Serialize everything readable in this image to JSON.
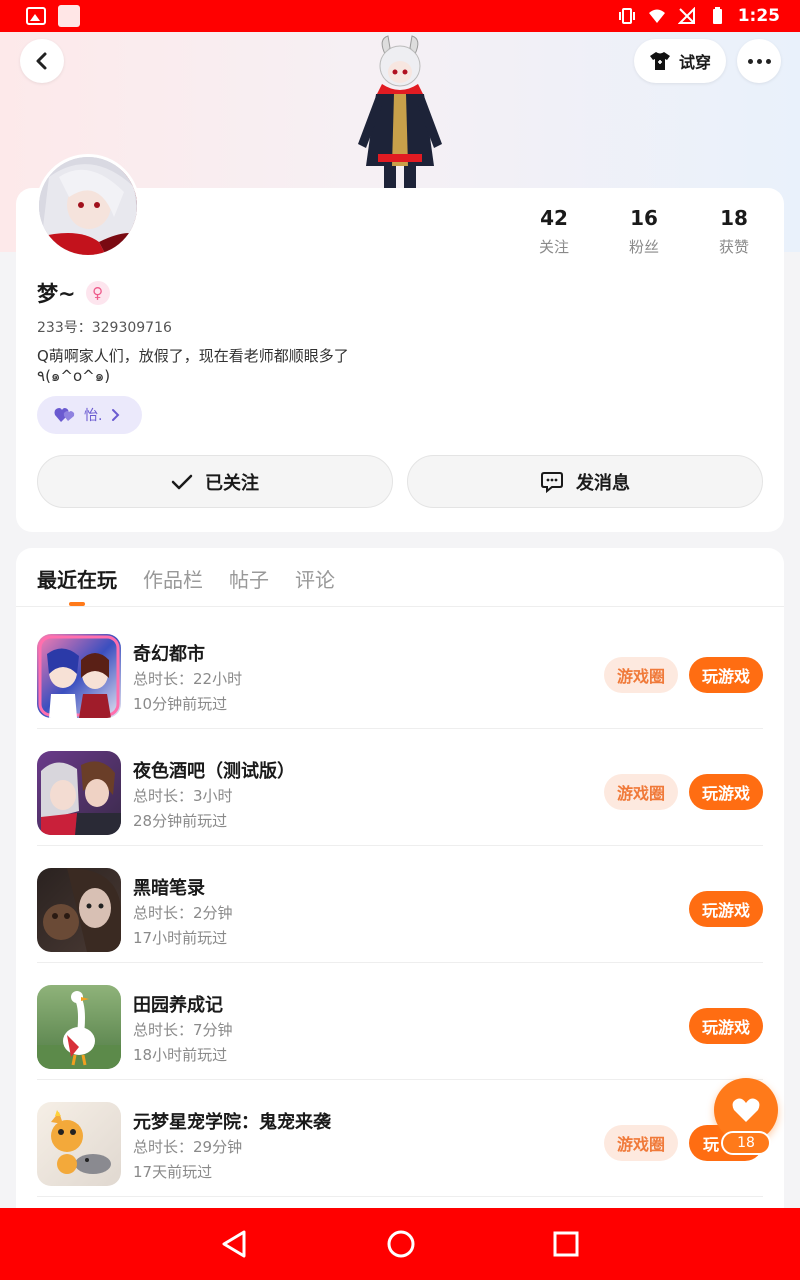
{
  "status_bar": {
    "time": "1:25"
  },
  "header": {
    "tryon_label": "试穿"
  },
  "profile": {
    "name": "梦~",
    "gender_symbol": "♀",
    "uid": "233号：329309716",
    "bio_line1": "Q萌啊家人们，放假了，现在看老师都顺眼多了",
    "bio_line2": "٩(๑^o^๑)",
    "tag_label": "怡.",
    "stats": [
      {
        "num": "42",
        "label": "关注"
      },
      {
        "num": "16",
        "label": "粉丝"
      },
      {
        "num": "18",
        "label": "获赞"
      }
    ],
    "follow_label": "已关注",
    "message_label": "发消息"
  },
  "tabs": [
    "最近在玩",
    "作品栏",
    "帖子",
    "评论"
  ],
  "games": [
    {
      "title": "奇幻都市",
      "duration": "总时长：22小时",
      "last_played": "10分钟前玩过",
      "circle": "游戏圈",
      "play": "玩游戏"
    },
    {
      "title": "夜色酒吧（测试版）",
      "duration": "总时长：3小时",
      "last_played": "28分钟前玩过",
      "circle": "游戏圈",
      "play": "玩游戏"
    },
    {
      "title": "黑暗笔录",
      "duration": "总时长：2分钟",
      "last_played": "17小时前玩过",
      "circle": "",
      "play": "玩游戏"
    },
    {
      "title": "田园养成记",
      "duration": "总时长：7分钟",
      "last_played": "18小时前玩过",
      "circle": "",
      "play": "玩游戏"
    },
    {
      "title": "元梦星宠学院：鬼宠来袭",
      "duration": "总时长：29分钟",
      "last_played": "17天前玩过",
      "circle": "游戏圈",
      "play": "玩"
    }
  ],
  "fab": {
    "count": "18"
  },
  "colors": {
    "accent": "#ff6d12",
    "status_bar": "#ff0000",
    "circle_bg": "#fde9df"
  }
}
